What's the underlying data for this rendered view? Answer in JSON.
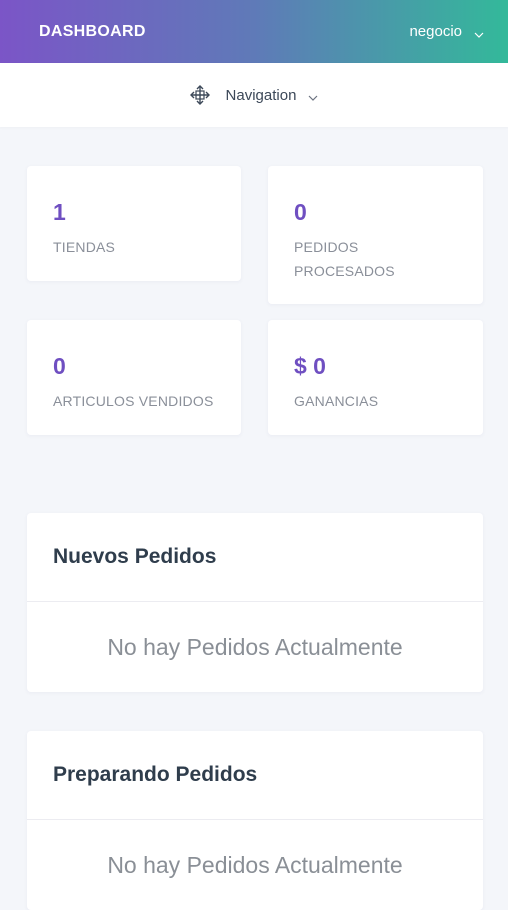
{
  "header": {
    "brand": "DASHBOARD",
    "user_menu_label": "negocio"
  },
  "navbar": {
    "label": "Navigation"
  },
  "stats": [
    {
      "value": "1",
      "label": "TIENDAS"
    },
    {
      "value": "0",
      "label": "PEDIDOS PROCESADOS"
    },
    {
      "value": "0",
      "label": "ARTICULOS VENDIDOS"
    },
    {
      "value": "$ 0",
      "label": "GANANCIAS"
    }
  ],
  "panels": [
    {
      "title": "Nuevos Pedidos",
      "empty_text": "No hay Pedidos Actualmente"
    },
    {
      "title": "Preparando Pedidos",
      "empty_text": "No hay Pedidos Actualmente"
    }
  ],
  "colors": {
    "accent": "#6f4fc1",
    "gradient_start": "#7b55c7",
    "gradient_end": "#33b99a"
  },
  "icons": {
    "user_menu": "chevron-down-icon",
    "nav": "compass-icon",
    "nav_dropdown": "chevron-down-icon"
  }
}
